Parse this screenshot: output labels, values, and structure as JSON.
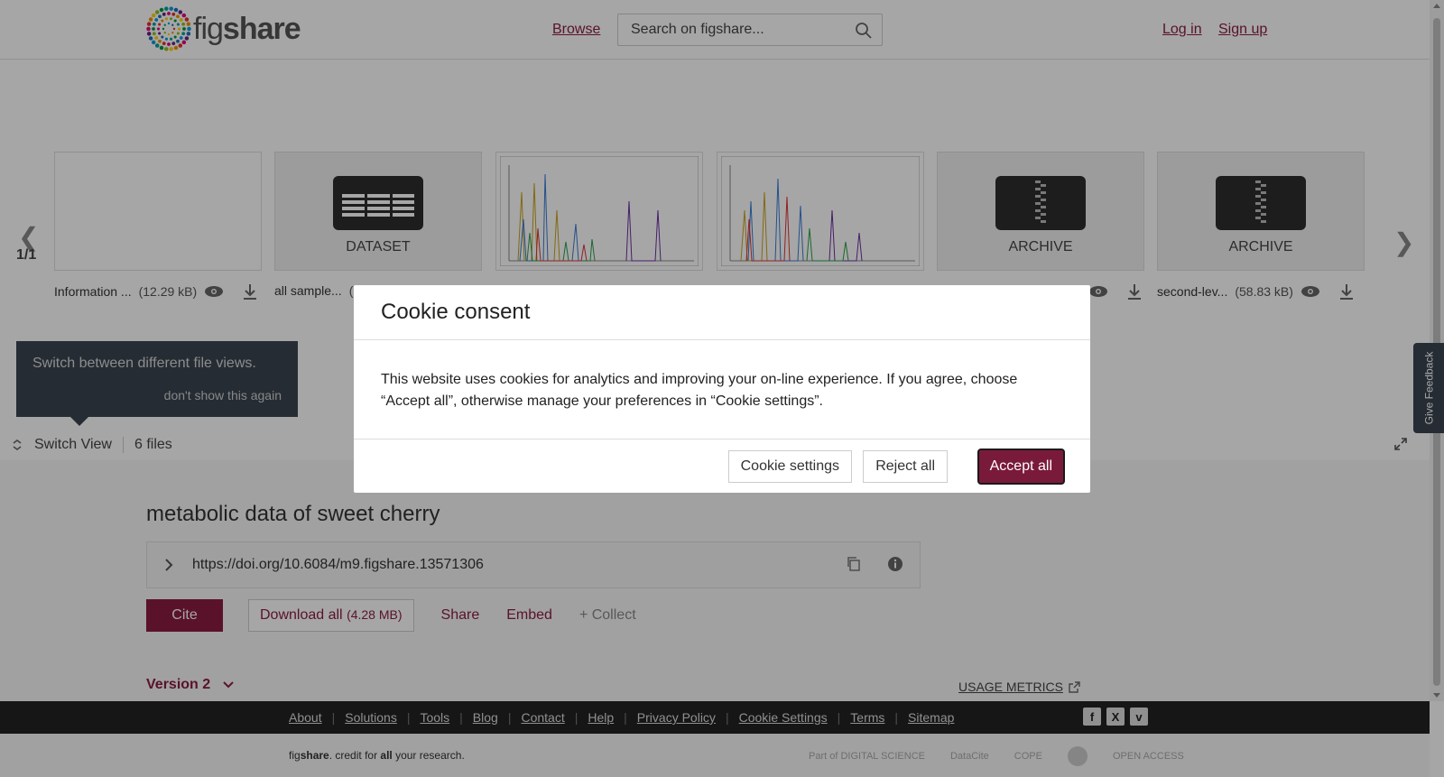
{
  "header": {
    "logo_text_fig": "fig",
    "logo_text_share": "share",
    "browse": "Browse",
    "search_placeholder": "Search on figshare...",
    "login": "Log in",
    "signup": "Sign up"
  },
  "viewer": {
    "pager_count": "1/1",
    "files": [
      {
        "type": "blank",
        "name": "Information ...",
        "size": "(12.29 kB)"
      },
      {
        "type": "DATASET",
        "name": "all sample...",
        "size": "("
      },
      {
        "type": "image",
        "name": "",
        "size": ""
      },
      {
        "type": "image",
        "name": "",
        "size": ""
      },
      {
        "type": "ARCHIVE",
        "name": "",
        "size": ""
      },
      {
        "type": "ARCHIVE",
        "name": "second-lev...",
        "size": "(58.83 kB)"
      }
    ],
    "tooltip_message": "Switch between different file views.",
    "tooltip_dismiss": "don't show this again",
    "switch_view": "Switch View",
    "file_count": "6 files"
  },
  "item": {
    "title": "metabolic data of sweet cherry",
    "doi": "https://doi.org/10.6084/m9.figshare.13571306",
    "cite": "Cite",
    "download_all": "Download all",
    "download_size": "(4.28 MB)",
    "share": "Share",
    "embed": "Embed",
    "collect": "+ Collect",
    "version": "Version 2",
    "usage_metrics": "USAGE METRICS"
  },
  "footer": {
    "links": [
      "About",
      "Solutions",
      "Tools",
      "Blog",
      "Contact",
      "Help",
      "Privacy Policy",
      "Cookie Settings",
      "Terms",
      "Sitemap"
    ],
    "tagline_fig": "fig",
    "tagline_share": "share",
    "tagline_mid": ". credit for ",
    "tagline_all": "all",
    "tagline_end": " your research.",
    "partners": [
      "Part of DIGITAL SCIENCE",
      "DataCite",
      "COPE",
      "",
      "OPEN ACCESS"
    ]
  },
  "feedback": "Give Feedback",
  "cookie_modal": {
    "title": "Cookie consent",
    "body": "This website uses cookies for analytics and improving your on-line experience. If you agree, choose “Accept all”, otherwise manage your preferences in “Cookie settings”.",
    "settings": "Cookie settings",
    "reject": "Reject all",
    "accept": "Accept all"
  },
  "colors": {
    "brand": "#8b1d41",
    "footer_bg": "#222222",
    "tooltip_bg": "#3a4450"
  }
}
